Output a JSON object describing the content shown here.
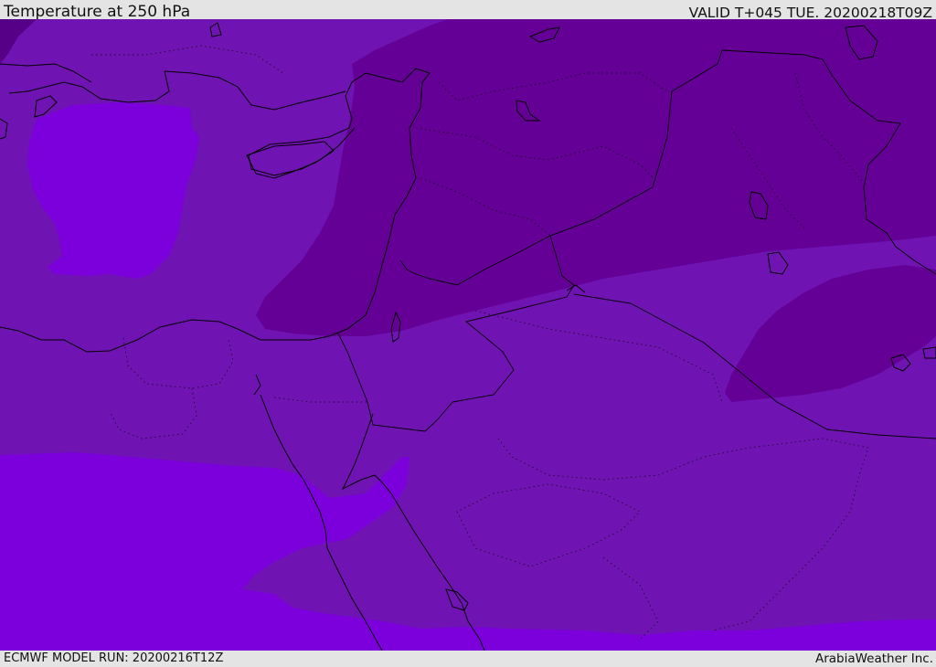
{
  "header": {
    "title": "Temperature at 250 hPa",
    "valid_time": "VALID T+045 TUE. 20200218T09Z"
  },
  "footer": {
    "model_run": "ECMWF MODEL RUN: 20200216T12Z",
    "credit": "ArabiaWeather Inc."
  },
  "map": {
    "variable": "temperature",
    "level_hpa": 250,
    "colors": {
      "warmest": "#7b00db",
      "mid": "#7013b3",
      "cold": "#640096",
      "coldest_corner": "#560088",
      "coastline": "#000000",
      "border_dotted": "#1a0a2a"
    }
  }
}
